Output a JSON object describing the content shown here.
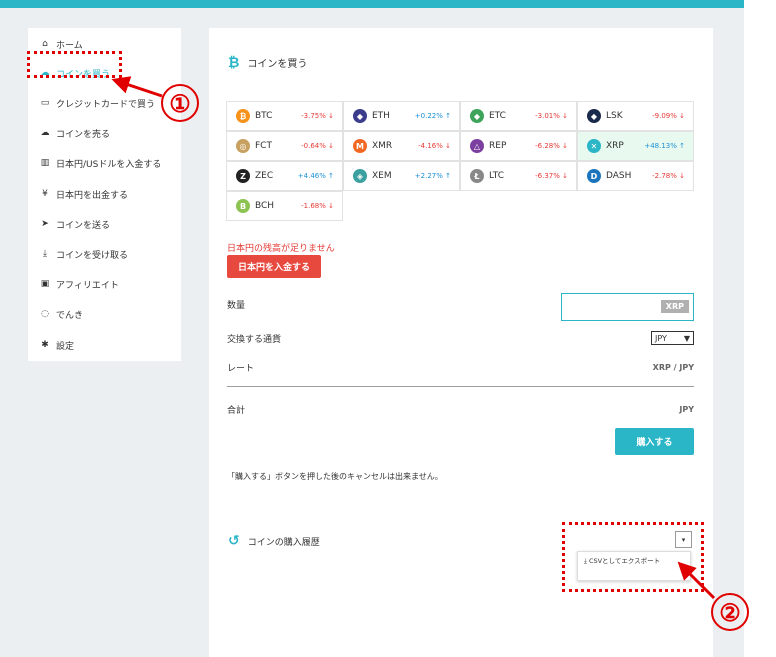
{
  "sidebar": {
    "items": [
      {
        "label": "ホーム",
        "icon": "home-icon",
        "glyph": "⌂"
      },
      {
        "label": "コインを買う",
        "icon": "cloud-upload-icon",
        "glyph": "☁",
        "active": true
      },
      {
        "label": "クレジットカードで買う",
        "icon": "credit-card-icon",
        "glyph": "▭"
      },
      {
        "label": "コインを売る",
        "icon": "cloud-upload-icon",
        "glyph": "☁"
      },
      {
        "label": "日本円/USドルを入金する",
        "icon": "bank-icon",
        "glyph": "▥"
      },
      {
        "label": "日本円を出金する",
        "icon": "yen-icon",
        "glyph": "¥"
      },
      {
        "label": "コインを送る",
        "icon": "paper-plane-icon",
        "glyph": "➤"
      },
      {
        "label": "コインを受け取る",
        "icon": "download-icon",
        "glyph": "⤓"
      },
      {
        "label": "アフィリエイト",
        "icon": "gift-icon",
        "glyph": "▣"
      },
      {
        "label": "でんき",
        "icon": "lightbulb-icon",
        "glyph": "◌"
      },
      {
        "label": "設定",
        "icon": "gear-icon",
        "glyph": "✱"
      }
    ]
  },
  "main": {
    "title": "コインを買う",
    "coins": [
      {
        "symbol": "BTC",
        "change": "-3.75%",
        "dir": "down",
        "color": "#f7931a",
        "glyph": "₿"
      },
      {
        "symbol": "ETH",
        "change": "+0.22%",
        "dir": "up",
        "color": "#3c3c8c",
        "glyph": "◆"
      },
      {
        "symbol": "ETC",
        "change": "-3.01%",
        "dir": "down",
        "color": "#3fa45b",
        "glyph": "◆"
      },
      {
        "symbol": "LSK",
        "change": "-9.09%",
        "dir": "down",
        "color": "#1a2a4a",
        "glyph": "◆"
      },
      {
        "symbol": "FCT",
        "change": "-0.64%",
        "dir": "down",
        "color": "#c8a060",
        "glyph": "◎"
      },
      {
        "symbol": "XMR",
        "change": "-4.16%",
        "dir": "down",
        "color": "#f26822",
        "glyph": "M"
      },
      {
        "symbol": "REP",
        "change": "-6.28%",
        "dir": "down",
        "color": "#7b3fa0",
        "glyph": "△"
      },
      {
        "symbol": "XRP",
        "change": "+48.13%",
        "dir": "up",
        "color": "#2ab6c6",
        "glyph": "✕",
        "highlight": true
      },
      {
        "symbol": "ZEC",
        "change": "+4.46%",
        "dir": "up",
        "color": "#222222",
        "glyph": "Z"
      },
      {
        "symbol": "XEM",
        "change": "+2.27%",
        "dir": "up",
        "color": "#3aa0a0",
        "glyph": "◈"
      },
      {
        "symbol": "LTC",
        "change": "-6.37%",
        "dir": "down",
        "color": "#888888",
        "glyph": "Ł"
      },
      {
        "symbol": "DASH",
        "change": "-2.78%",
        "dir": "down",
        "color": "#1c75bc",
        "glyph": "D"
      },
      {
        "symbol": "BCH",
        "change": "-1.68%",
        "dir": "down",
        "color": "#8dc351",
        "glyph": "B"
      }
    ],
    "warning": "日本円の残高が足りません",
    "deposit_button": "日本円を入金する",
    "quantity_label": "数量",
    "quantity_unit": "XRP",
    "currency_label": "交換する通貨",
    "currency_value": "JPY",
    "currency_caret": "▼",
    "rate_label": "レート",
    "rate_value": "XRP / JPY",
    "total_label": "合計",
    "total_value": "JPY",
    "buy_button": "購入する",
    "note": "「購入する」ボタンを押した後のキャンセルは出来ません。",
    "history_title": "コインの購入履歴",
    "dropdown_caret": "▾",
    "export_label": "⤓ CSVとしてエクスポート"
  },
  "annotations": {
    "marker1": "①",
    "marker2": "②",
    "color": "#e00000"
  }
}
